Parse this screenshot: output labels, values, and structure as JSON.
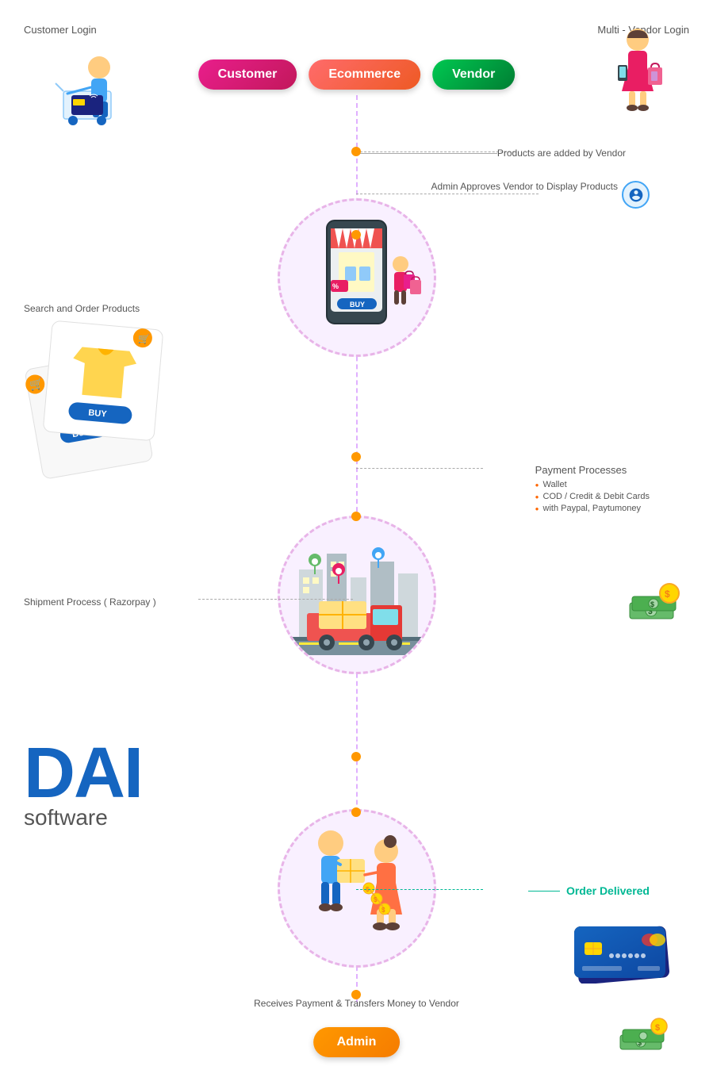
{
  "header": {
    "customer_login": "Customer\nLogin",
    "multi_vendor_login": "Multi - Vendor\nLogin"
  },
  "pills": {
    "customer": "Customer",
    "ecommerce": "Ecommerce",
    "vendor": "Vendor",
    "admin": "Admin"
  },
  "flow_labels": {
    "products_added": "Products are added by Vendor",
    "admin_approves": "Admin Approves Vendor to Display Products",
    "search_order": "Search and Order Products",
    "payment_processes": "Payment Processes",
    "payment_items": [
      "Wallet",
      "COD / Credit & Debit Cards",
      "with Paypal, Paytumoney"
    ],
    "shipment_process": "Shipment Process\n( Razorpay )",
    "order_delivered": "Order Delivered",
    "receives_payment": "Receives Payment & Transfers Money to Vendor"
  },
  "logo": {
    "dai": "DAI",
    "software": "software"
  },
  "colors": {
    "pink": "#e91e8c",
    "orange_pill": "#ff9800",
    "green": "#00c851",
    "teal": "#00b894",
    "blue": "#1565c0",
    "center_line": "#e0b0ff",
    "dot_orange": "#ff9800"
  }
}
